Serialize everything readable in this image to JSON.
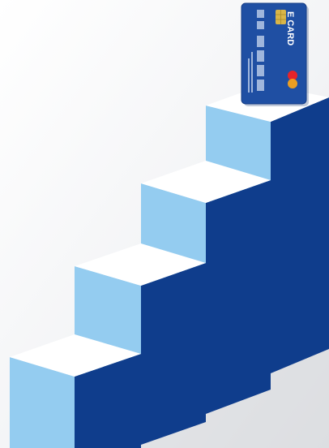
{
  "card": {
    "label": "E CARD",
    "brand_icon": "mastercard-circles-icon",
    "chip_icon": "chip-icon"
  },
  "colors": {
    "step_front": "#0f3d8c",
    "step_side_light": "#94ccf0",
    "step_top": "#ffffff",
    "card_body": "#1f4fa3",
    "card_chip": "#d9b548",
    "brand_red": "#e6242a",
    "brand_orange": "#f7a21b",
    "background": "#eef0f2"
  }
}
